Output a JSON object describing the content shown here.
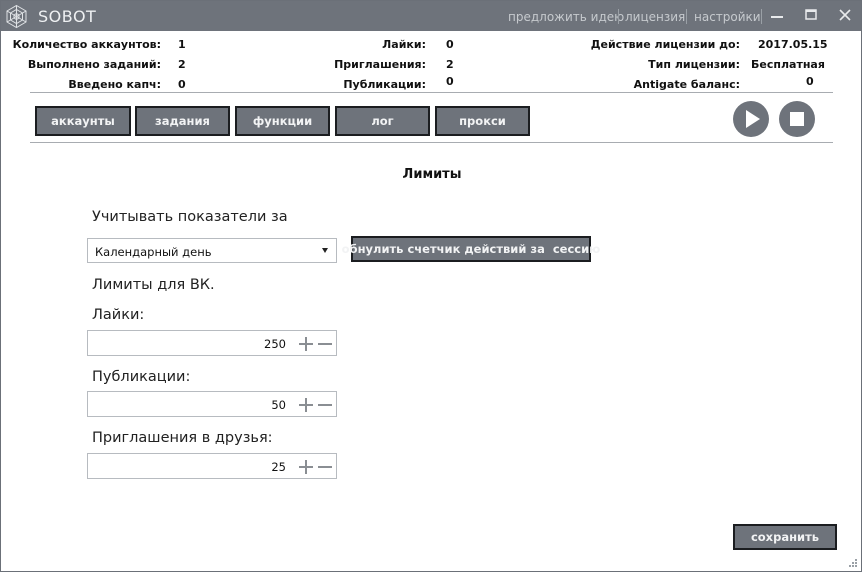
{
  "titlebar": {
    "app_title": "SOBOT",
    "links": [
      "предложить идею",
      "лицензия",
      "настройки"
    ]
  },
  "stats": {
    "accounts_label": "Количество аккаунтов:",
    "accounts_value": "1",
    "tasks_done_label": "Выполнено заданий:",
    "tasks_done_value": "2",
    "captcha_label": "Введено капч:",
    "captcha_value": "0",
    "likes_label": "Лайки:",
    "likes_value": "0",
    "invites_label": "Приглашения:",
    "invites_value": "2",
    "posts_label": "Публикации:",
    "posts_value": "0",
    "license_until_label": "Действие лицензии до:",
    "license_until_value": "2017.05.15",
    "license_type_label": "Тип лицензии:",
    "license_type_value": "Бесплатная",
    "antigate_label": "Antigate баланс:",
    "antigate_value": "0"
  },
  "nav": {
    "tabs": [
      "аккаунты",
      "задания",
      "функции",
      "лог",
      "прокси"
    ]
  },
  "limits": {
    "title": "Лимиты",
    "period_label": "Учитывать показатели за",
    "period_selected": "Календарный день",
    "reset_button": "обнулить счетчик действий за  сессию",
    "vk_label": "Лимиты для ВК.",
    "likes_label": "Лайки:",
    "likes_value": "250",
    "posts_label": "Публикации:",
    "posts_value": "50",
    "invites_label": "Приглашения в друзья:",
    "invites_value": "25",
    "save_button": "сохранить"
  },
  "colors": {
    "titlebar_bg": "#6e737b",
    "button_bg": "#6e737b",
    "button_border": "#1b1d20",
    "link_color": "#c6cace"
  },
  "icons": {
    "logo": "spiderweb-logo",
    "play": "play-icon",
    "stop": "stop-icon",
    "plus": "plus-icon",
    "minus": "minus-icon"
  }
}
